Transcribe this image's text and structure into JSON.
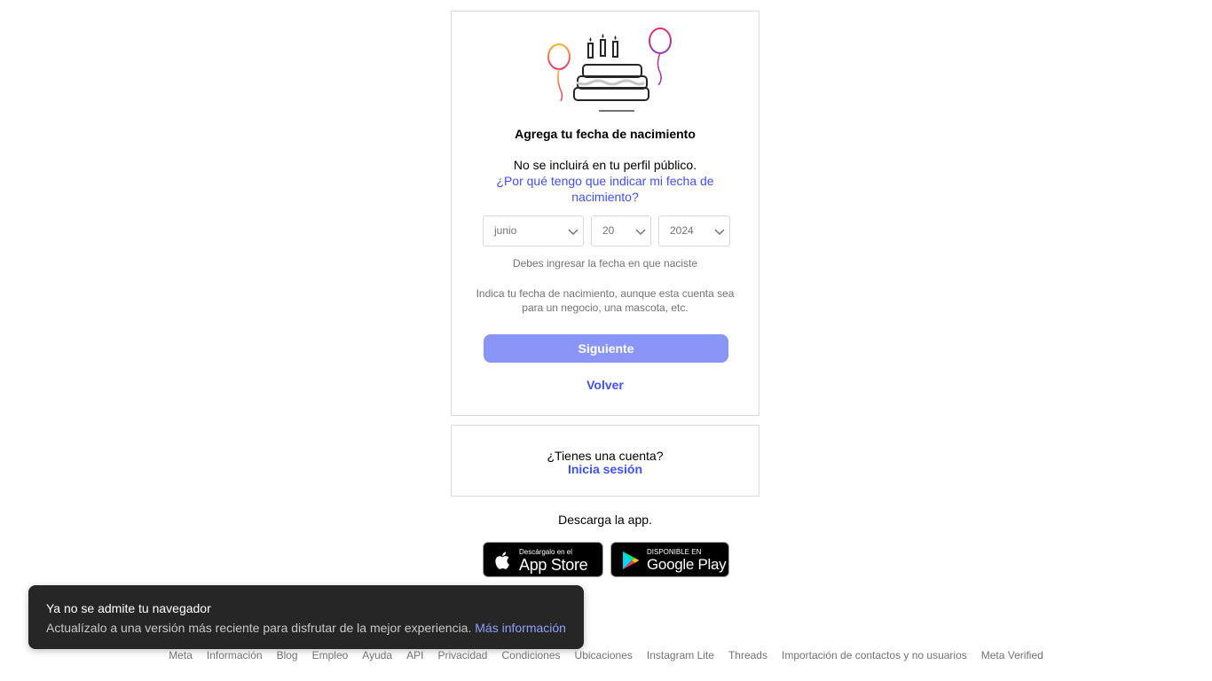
{
  "signup_birthday": {
    "title": "Agrega tu fecha de nacimiento",
    "subtitle": "No se incluirá en tu perfil público.",
    "why_link": "¿Por qué tengo que indicar mi fecha de nacimiento?",
    "month_value": "junio",
    "day_value": "20",
    "year_value": "2024",
    "helper_text": "Debes ingresar la fecha en que naciste",
    "note": "Indica tu fecha de nacimiento, aunque esta cuenta sea para un negocio, una mascota, etc.",
    "next_label": "Siguiente",
    "back_label": "Volver"
  },
  "login_box": {
    "question": "¿Tienes una cuenta?",
    "login_label": "Inicia sesión"
  },
  "get_app": {
    "label": "Descarga la app.",
    "app_store_small": "Descárgalo en el",
    "app_store_big": "App Store",
    "google_play_small": "DISPONIBLE EN",
    "google_play_big": "Google Play"
  },
  "toast": {
    "title": "Ya no se admite tu navegador",
    "body": "Actualízalo a una versión más reciente para disfrutar de la mejor experiencia.",
    "link": "Más información"
  },
  "footer": {
    "links": [
      "Meta",
      "Información",
      "Blog",
      "Empleo",
      "Ayuda",
      "API",
      "Privacidad",
      "Condiciones",
      "Ubicaciones",
      "Instagram Lite",
      "Threads",
      "Importación de contactos y no usuarios",
      "Meta Verified"
    ]
  },
  "colors": {
    "link_blue": "#4150f7",
    "button_disabled": "#8a95f8",
    "toast_bg": "#262626",
    "border": "#dbdbdb"
  }
}
